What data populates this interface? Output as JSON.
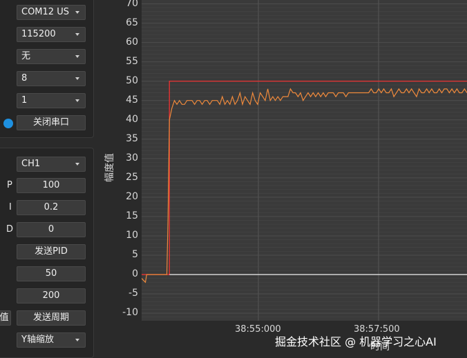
{
  "serial": {
    "port": "COM12 US",
    "baud": "115200",
    "parity": "无",
    "data_bits": "8",
    "stop_bits": "1",
    "close_label": "关闭串口",
    "status_color": "#1e90e0"
  },
  "pid": {
    "channel": "CH1",
    "p_label": "P",
    "p_value": "100",
    "i_label": "I",
    "i_value": "0.2",
    "d_label": "D",
    "d_value": "0",
    "send_pid_label": "发送PID",
    "field_a": "50",
    "field_b": "200",
    "partial_label": "值",
    "send_period_label": "发送周期",
    "y_zoom": "Y轴缩放"
  },
  "chart_data": {
    "type": "line",
    "ylabel": "幅度值",
    "xlabel": "时间",
    "ylim": [
      -12,
      70
    ],
    "y_ticks": [
      "70",
      "65",
      "60",
      "55",
      "50",
      "45",
      "40",
      "35",
      "30",
      "25",
      "20",
      "15",
      "10",
      "5",
      "0",
      "-5",
      "-10"
    ],
    "x_ticks": [
      "38:55:000",
      "38:57:500"
    ],
    "grid": true,
    "series": [
      {
        "color": "#ff3030",
        "x": [
          0,
          11,
          11,
          129
        ],
        "y": [
          0,
          0,
          50,
          50
        ]
      },
      {
        "color": "#f08a3c",
        "x": [
          0,
          1.5,
          2,
          3,
          5,
          7,
          8,
          9,
          10,
          10.5,
          11,
          12,
          13,
          14,
          15,
          16,
          17,
          18,
          19,
          20,
          21,
          22,
          23,
          24,
          25,
          26,
          27,
          28,
          29,
          30,
          31,
          32,
          33,
          34,
          35,
          36,
          37,
          38,
          39,
          40,
          41,
          42,
          43,
          44,
          45,
          46,
          47,
          48,
          49,
          50,
          51,
          52,
          53,
          54,
          55,
          56,
          57,
          58,
          59,
          60,
          61,
          62,
          63,
          64,
          65,
          66,
          67,
          68,
          69,
          70,
          71,
          72,
          73,
          74,
          75,
          76,
          77,
          78,
          79,
          80,
          81,
          82,
          83,
          84,
          85,
          86,
          87,
          88,
          89,
          90,
          91,
          92,
          93,
          94,
          95,
          96,
          97,
          98,
          99,
          100,
          101,
          102,
          103,
          104,
          105,
          106,
          107,
          108,
          109,
          110,
          111,
          112,
          113,
          114,
          115,
          116,
          117,
          118,
          119,
          120,
          121,
          122,
          123,
          124,
          125,
          126,
          127,
          128,
          129
        ],
        "y": [
          -1,
          -2,
          0,
          0,
          0,
          0,
          0,
          0,
          0,
          15,
          40,
          43,
          45,
          44,
          45,
          44,
          44,
          45,
          45,
          45,
          44,
          45,
          45,
          44,
          45,
          45,
          44,
          45,
          45,
          45,
          44,
          46,
          44,
          45,
          44,
          46,
          44,
          45,
          47,
          44,
          46,
          45,
          44,
          47,
          45,
          44,
          47,
          46,
          45,
          48,
          45,
          46,
          45,
          46,
          45,
          46,
          46,
          46,
          48,
          47,
          47,
          46,
          47,
          45,
          46,
          47,
          46,
          47,
          46,
          47,
          46,
          47,
          46,
          47,
          47,
          47,
          46,
          47,
          47,
          47,
          46,
          47,
          47,
          47,
          47,
          47,
          47,
          47,
          47,
          47,
          48,
          47,
          47,
          48,
          47,
          48,
          47,
          47,
          48,
          46,
          47,
          48,
          47,
          47,
          48,
          47,
          48,
          47,
          46,
          48,
          47,
          47,
          48,
          47,
          48,
          47,
          47,
          48,
          47,
          48,
          48,
          47,
          48,
          47,
          48,
          47,
          47,
          48,
          47
        ]
      },
      {
        "color": "#f2f2f2",
        "x": [
          11,
          129
        ],
        "y": [
          0,
          0
        ]
      }
    ]
  },
  "watermark": "掘金技术社区 @ 机器学习之心AI"
}
